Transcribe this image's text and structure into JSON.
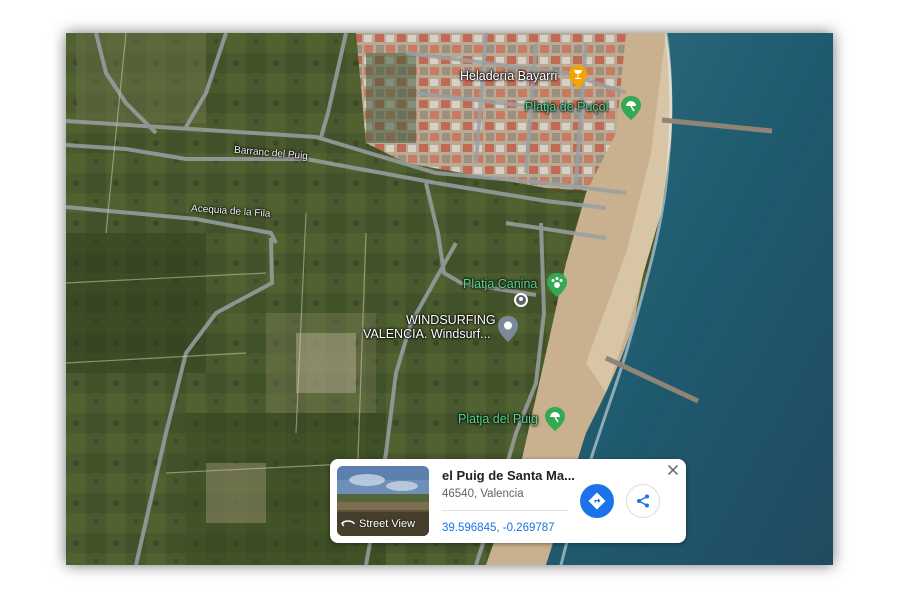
{
  "map": {
    "type": "satellite",
    "road_labels": {
      "barranc": "Barranc del Puig",
      "acequia": "Acequia de la Fila"
    },
    "pois": {
      "heladeria": {
        "label": "Heladería Bayarri",
        "icon": "ice-cream-icon",
        "color": "#f4a300"
      },
      "platja_pucol": {
        "label": "Platja de Puçol",
        "icon": "beach-umbrella-icon",
        "color": "#34a853"
      },
      "platja_canina": {
        "label": "Platja Canina",
        "icon": "paw-icon",
        "color": "#34a853"
      },
      "windsurfing_line1": "WINDSURFING",
      "windsurfing_line2": "VALENCIA. Windsurf...",
      "windsurfing_icon": "windsurf-pin-icon",
      "platja_puig": {
        "label": "Platja del Puig",
        "icon": "beach-umbrella-icon",
        "color": "#34a853"
      }
    }
  },
  "info_card": {
    "street_view_label": "Street View",
    "place_name": "el Puig de Santa Ma...",
    "address": "46540, Valencia",
    "coordinates": "39.596845, -0.269787",
    "directions_icon": "directions-icon",
    "share_icon": "share-icon",
    "close_icon": "close-icon",
    "accent_color": "#1a73e8"
  }
}
